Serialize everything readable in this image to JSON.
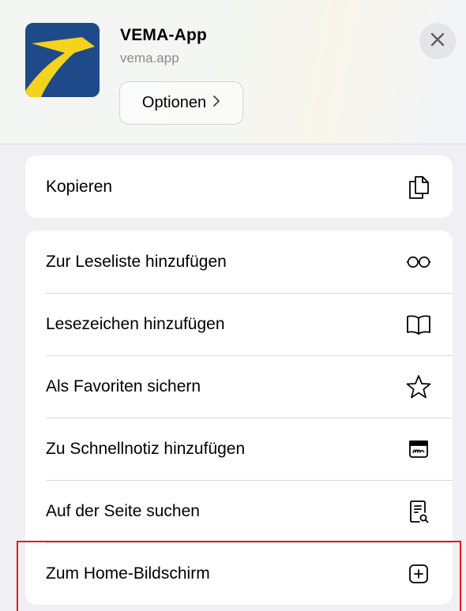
{
  "header": {
    "app_name": "VEMA-App",
    "app_url": "vema.app",
    "options_label": "Optionen",
    "icons": {
      "app": "vema-app-logo",
      "close": "close-icon",
      "options_chevron": "chevron-right-icon"
    }
  },
  "groups": [
    {
      "rows": [
        {
          "label": "Kopieren",
          "icon": "copy-icon"
        }
      ]
    },
    {
      "rows": [
        {
          "label": "Zur Leseliste hinzufügen",
          "icon": "glasses-icon"
        },
        {
          "label": "Lesezeichen hinzufügen",
          "icon": "book-icon"
        },
        {
          "label": "Als Favoriten sichern",
          "icon": "star-icon"
        },
        {
          "label": "Zu Schnellnotiz hinzufügen",
          "icon": "quick-note-icon"
        },
        {
          "label": "Auf der Seite suchen",
          "icon": "find-on-page-icon"
        },
        {
          "label": "Zum Home-Bildschirm",
          "icon": "add-square-icon",
          "highlighted": true
        }
      ]
    }
  ],
  "colors": {
    "highlight": "#e8191c",
    "logo_blue": "#1f4a8a",
    "logo_yellow": "#f5d21e"
  }
}
